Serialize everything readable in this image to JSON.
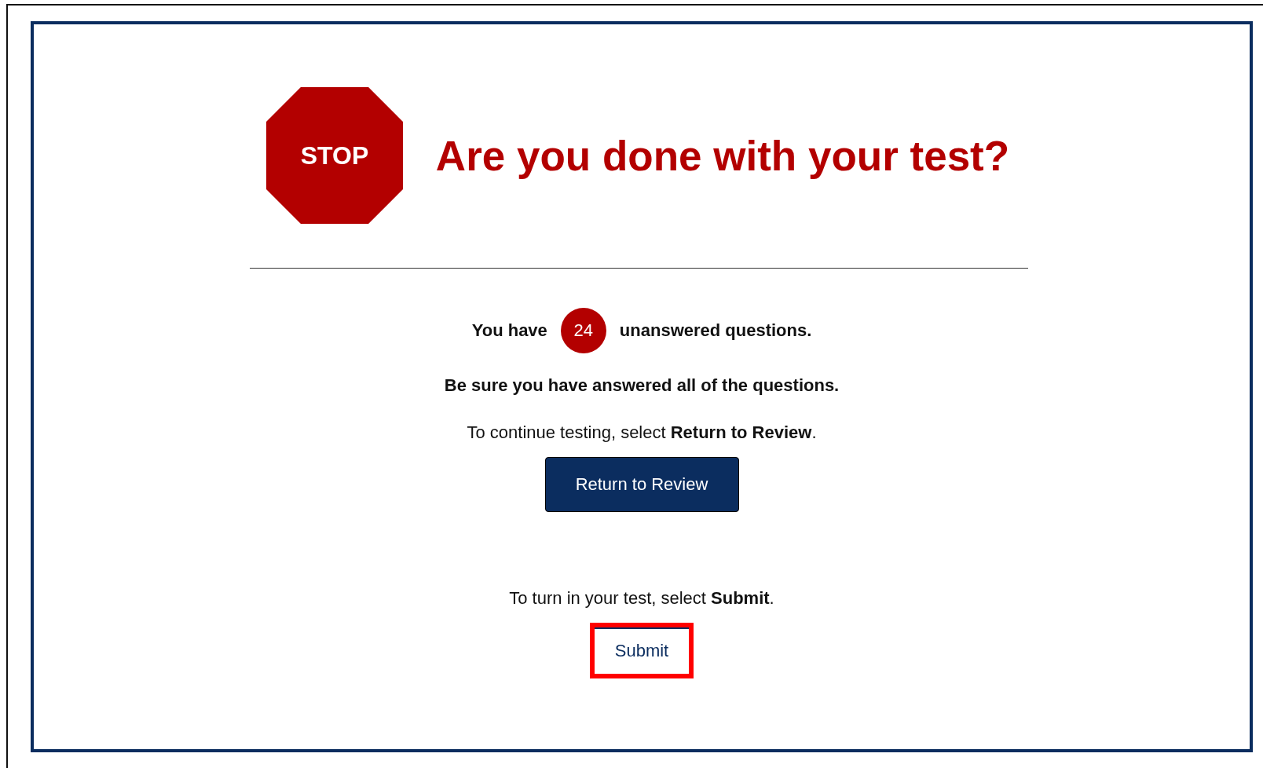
{
  "stop_sign": {
    "label": "STOP"
  },
  "title": "Are you done with your test?",
  "unanswered": {
    "before": "You have",
    "count": "24",
    "after": "unanswered questions."
  },
  "reminder": "Be sure you have answered all of the questions.",
  "continue_text": "To continue testing, select **Return to Review**.",
  "return_button": {
    "label": "Return to Review"
  },
  "submit_text": "To turn in your test, select **Submit**.",
  "submit_button": {
    "label": "Submit",
    "highlighted": true
  }
}
